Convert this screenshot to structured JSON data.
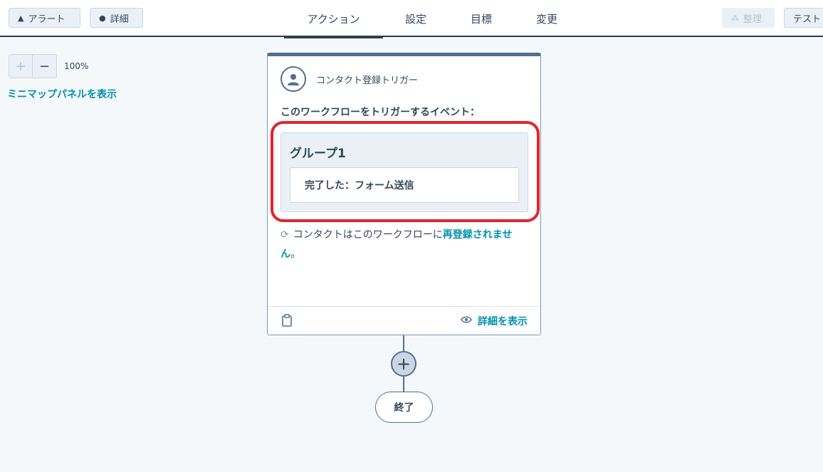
{
  "toolbar": {
    "alerts_label": "アラート",
    "details_label": "詳細",
    "organize_label": "整理",
    "test_label": "テスト"
  },
  "tabs": [
    {
      "label": "アクション",
      "active": true
    },
    {
      "label": "設定",
      "active": false
    },
    {
      "label": "目標",
      "active": false
    },
    {
      "label": "変更",
      "active": false
    }
  ],
  "zoom": {
    "plus": "+",
    "minus": "−",
    "level": "100%"
  },
  "minimap_link": "ミニマップパネルを表示",
  "trigger": {
    "title": "コンタクト登録トリガー",
    "event_label": "このワークフローをトリガーするイベント：",
    "group_title": "グループ1",
    "filter": "完了した：フォーム送信",
    "reenroll_prefix": "コンタクトはこのワークフローに",
    "reenroll_link": "再登録されません",
    "reenroll_suffix": "。",
    "details_link": "詳細を表示"
  },
  "flow": {
    "add": "+",
    "end_label": "終了"
  },
  "colors": {
    "accent": "#0091ae",
    "highlight": "#e0262e",
    "dark": "#2d3e50"
  },
  "icons": {
    "alerts": "warning-icon",
    "details": "info-icon",
    "organize": "organize-icon",
    "trigger": "contact-avatar-icon",
    "reenroll": "refresh-icon",
    "clipboard": "clipboard-icon",
    "view": "eye-icon"
  }
}
